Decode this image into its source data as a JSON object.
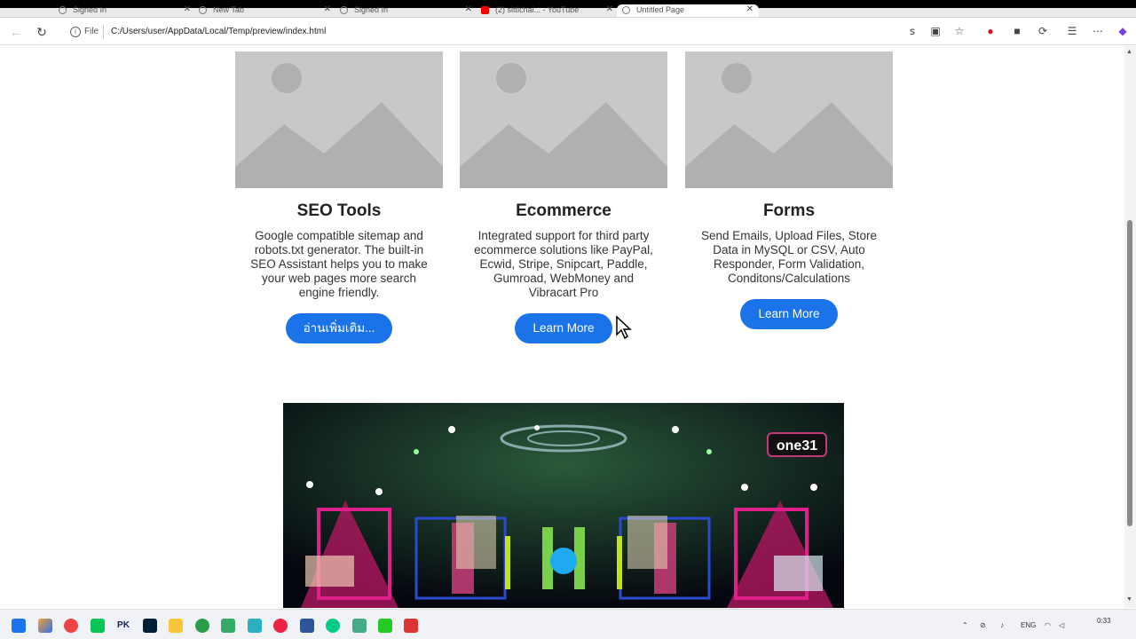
{
  "browser": {
    "tabs": [
      {
        "label": "Signed In",
        "active": false
      },
      {
        "label": "New Tab",
        "active": false
      },
      {
        "label": "Signed In",
        "active": false
      },
      {
        "label": "(2) sittichai... - YouTube",
        "active": false
      },
      {
        "label": "Untitled Page",
        "active": true
      }
    ],
    "address": {
      "scheme": "File",
      "url": "C:/Users/user/AppData/Local/Temp/preview/index.html"
    }
  },
  "cards": [
    {
      "title": "SEO Tools",
      "text": "Google compatible sitemap and robots.txt generator. The built-in SEO Assistant helps you to make your web pages more search engine friendly.",
      "button": "อ่านเพิ่มเติม..."
    },
    {
      "title": "Ecommerce",
      "text": "Integrated support for third party ecommerce solutions like PayPal, Ecwid, Stripe, Snipcart, Paddle, Gumroad, WebMoney and Vibracart Pro",
      "button": "Learn More"
    },
    {
      "title": "Forms",
      "text": "Send Emails, Upload Files, Store Data in MySQL or CSV, Auto Responder, Form Validation, Conditons/Calculations",
      "button": "Learn More"
    }
  ],
  "video": {
    "channel_logo": "one31"
  },
  "taskbar": {
    "language": "ENG",
    "time": "0:33"
  },
  "colors": {
    "accent": "#1a73e8",
    "placeholder": "#c8c8c8"
  }
}
